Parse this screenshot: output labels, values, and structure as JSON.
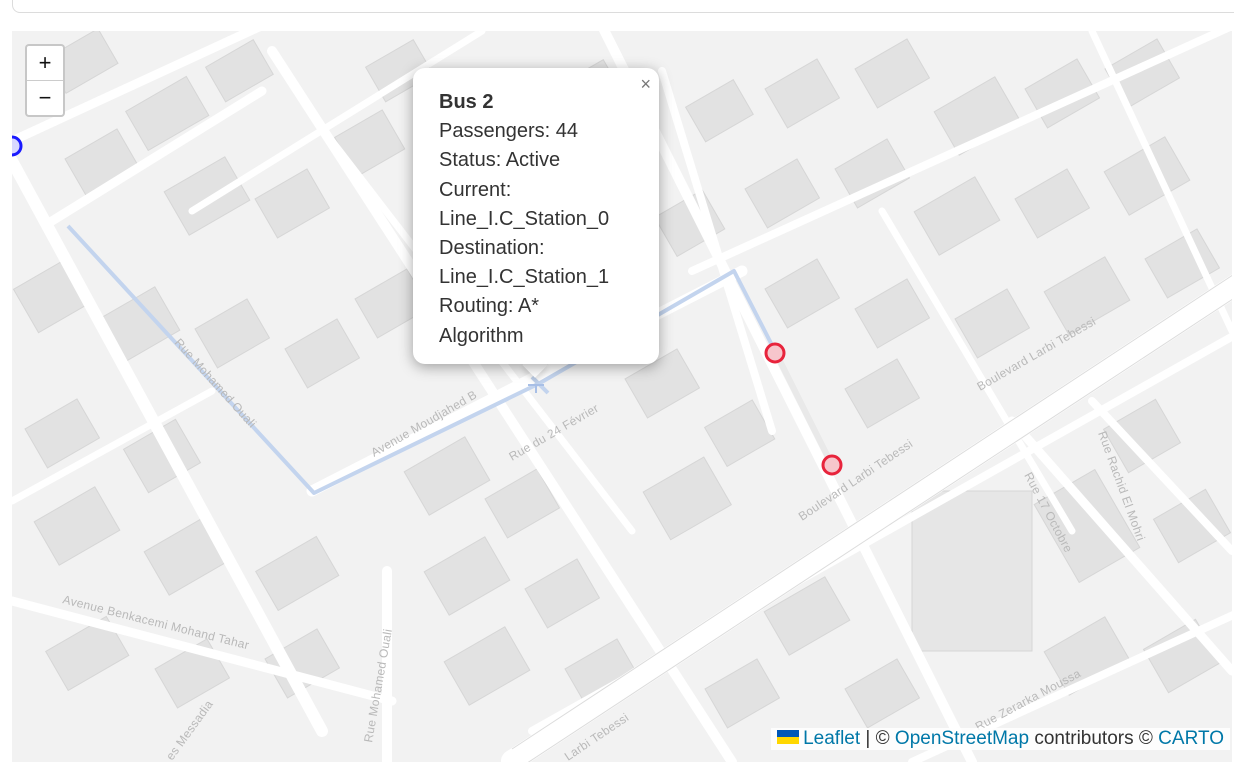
{
  "map": {
    "zoom_in_label": "+",
    "zoom_out_label": "−",
    "street_names": {
      "rue_mohamed_ouali_upper": "Rue Mohamed Ouali",
      "rue_mohamed_ouali_lower": "Rue Mohamed Ouali",
      "avenue_moudjahed": "Avenue Moudjahed B",
      "rue_24_fevrier": "Rue du 24 Février",
      "boulevard_larbi_tebessi_1": "Boulevard Larbi Tebessi",
      "boulevard_larbi_tebessi_2": "Boulevard Larbi Tebessi",
      "larbi_tebessi_lower": "Larbi Tebessi",
      "rue_17_octobre": "Rue 17 Octobre",
      "rue_rachid_el_mohri": "Rue Rachid El Mohri",
      "avenue_benkacemi": "Avenue Benkacemi Mohand Tahar",
      "rue_zerarka_moussa": "Rue Zerarka Moussa",
      "es_messadia": "es Messadia"
    },
    "route_color": "#c3d4ee",
    "station_color": "#e8243c",
    "bus_marker_color": "#1a1aff"
  },
  "popup": {
    "close_label": "×",
    "title": "Bus 2",
    "passengers": "Passengers: 44",
    "status": "Status: Active",
    "current_label": "Current:",
    "current_value": "Line_I.C_Station_0",
    "destination_label": "Destination:",
    "destination_value": "Line_I.C_Station_1",
    "routing": "Routing: A*",
    "routing_cont": "Algorithm"
  },
  "attribution": {
    "leaflet": "Leaflet",
    "sep": " | © ",
    "osm": "OpenStreetMap",
    "contributors": " contributors © ",
    "carto": "CARTO"
  }
}
